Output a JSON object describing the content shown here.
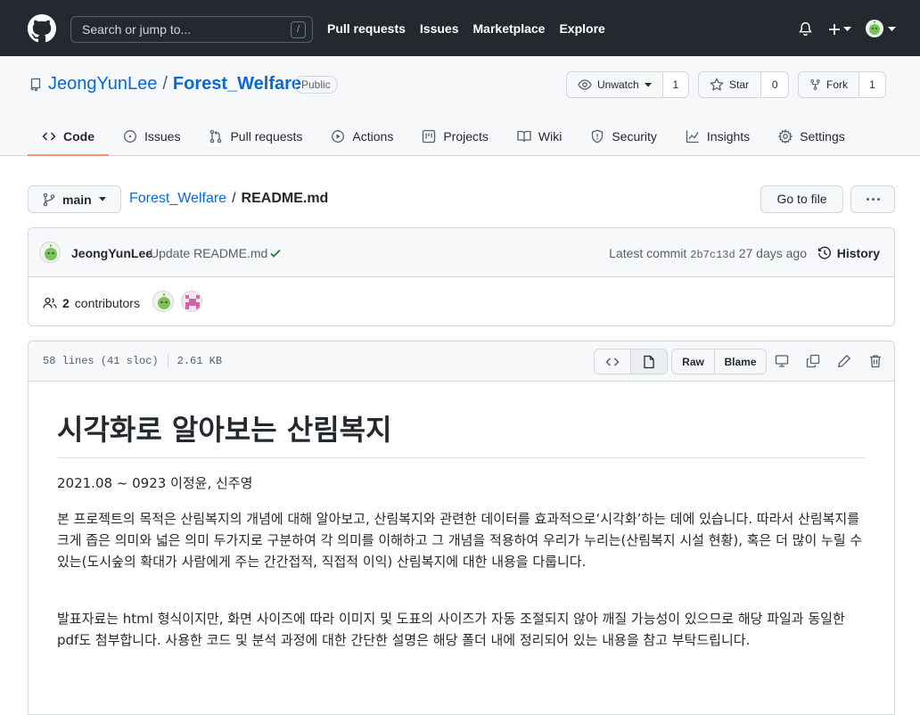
{
  "header": {
    "search_placeholder": "Search or jump to...",
    "search_key": "/",
    "nav": [
      "Pull requests",
      "Issues",
      "Marketplace",
      "Explore"
    ]
  },
  "repo": {
    "owner": "JeongYunLee",
    "separator": "/",
    "name": "Forest_Welfare",
    "visibility": "Public",
    "watch": {
      "label": "Unwatch",
      "count": "1"
    },
    "star": {
      "label": "Star",
      "count": "0"
    },
    "fork": {
      "label": "Fork",
      "count": "1"
    }
  },
  "tabs": [
    {
      "label": "Code",
      "icon": "code-icon",
      "selected": true
    },
    {
      "label": "Issues",
      "icon": "issue-icon"
    },
    {
      "label": "Pull requests",
      "icon": "pull-request-icon"
    },
    {
      "label": "Actions",
      "icon": "play-icon"
    },
    {
      "label": "Projects",
      "icon": "project-icon"
    },
    {
      "label": "Wiki",
      "icon": "book-icon"
    },
    {
      "label": "Security",
      "icon": "shield-icon"
    },
    {
      "label": "Insights",
      "icon": "graph-icon"
    },
    {
      "label": "Settings",
      "icon": "gear-icon"
    }
  ],
  "file_nav": {
    "branch": "main",
    "breadcrumb_repo": "Forest_Welfare",
    "breadcrumb_sep": "/",
    "breadcrumb_file": "README.md",
    "goto_label": "Go to file"
  },
  "commit": {
    "author": "JeongYunLee",
    "message": "Update README.md",
    "latest_label": "Latest commit",
    "sha": "2b7c13d",
    "age": "27 days ago",
    "history_label": "History",
    "contributors_count": "2",
    "contributors_label": "contributors"
  },
  "file": {
    "lines": "58 lines (41 sloc)",
    "size": "2.61 KB",
    "raw_label": "Raw",
    "blame_label": "Blame"
  },
  "readme": {
    "title": "시각화로 알아보는 산림복지",
    "meta": "2021.08 ~ 0923 이정윤, 신주영",
    "para1": "본 프로젝트의 목적은 산림복지의 개념에 대해 알아보고, 산림복지와 관련한 데이터를 효과적으로‘시각화’하는 데에 있습니다. 따라서 산림복지를 크게 좁은 의미와 넓은 의미 두가지로 구분하여 각 의미를 이해하고 그 개념을 적용하여 우리가 누리는(산림복지 시설 현황), 혹은 더 많이 누릴 수 있는(도시숲의 확대가 사람에게 주는 간간접적, 직접적 이익) 산림복지에 대한 내용을 다룹니다.",
    "para2": "발표자료는 html 형식이지만, 화면 사이즈에 따라 이미지 및 도표의 사이즈가 자동 조절되지 않아 깨질 가능성이 있으므로 해당 파일과 동일한 pdf도 첨부합니다. 사용한 코드 및 분석 과정에 대한 간단한 설명은 해당 폴더 내에 정리되어 있는 내용을 참고 부탁드립니다."
  }
}
